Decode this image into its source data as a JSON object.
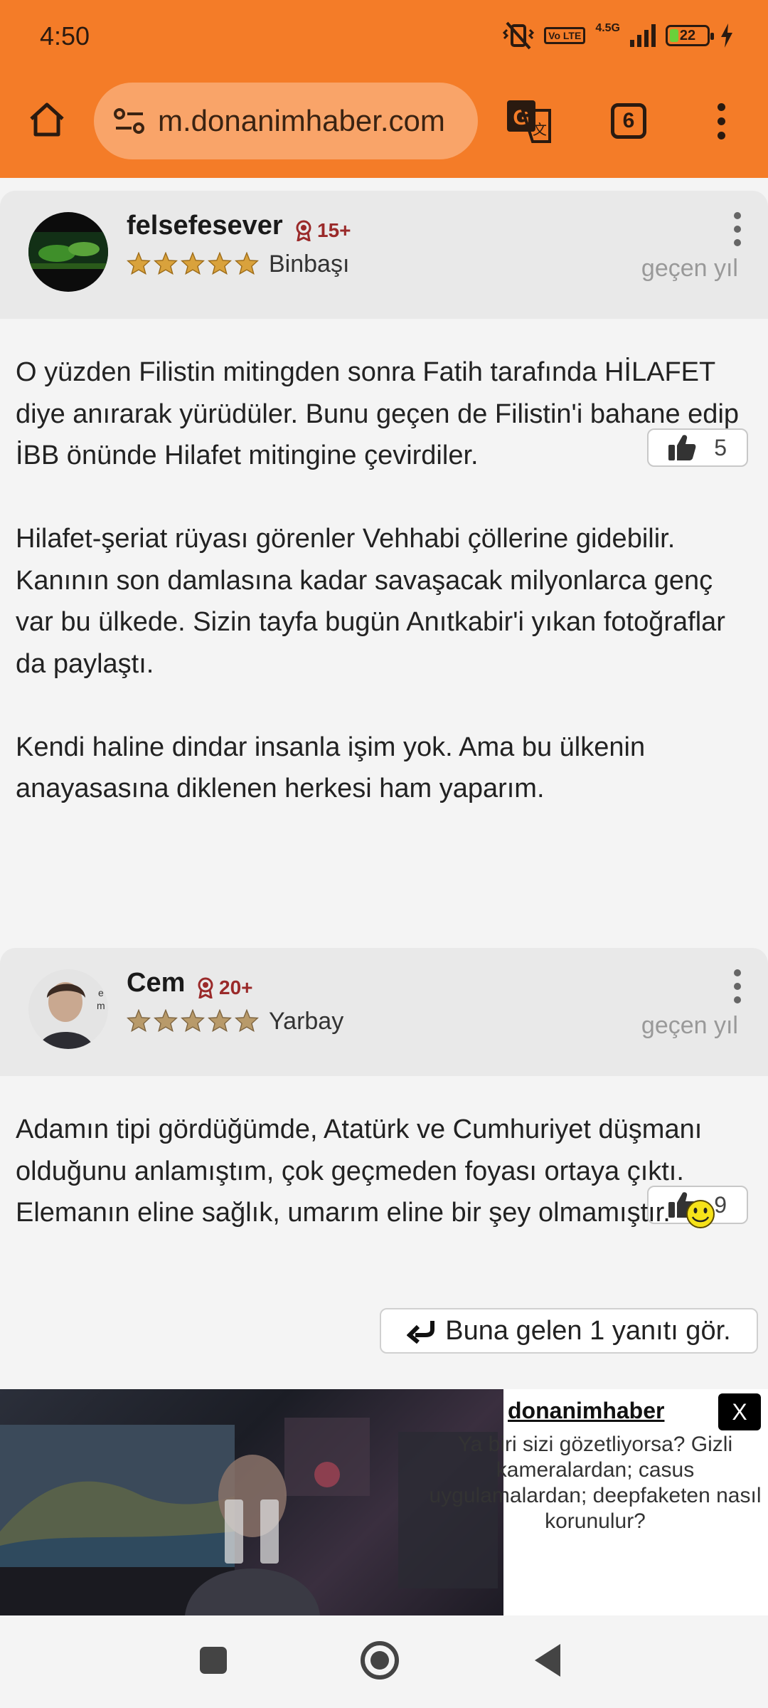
{
  "status_bar": {
    "time": "4:50",
    "network": "4.5G",
    "volte": "Vo LTE",
    "battery": "22"
  },
  "browser": {
    "url": "m.donanimhaber.com",
    "tab_count": "6"
  },
  "comments": [
    {
      "username": "felsefesever",
      "badge": "15+",
      "rank": "Binbaşı",
      "time": "geçen yıl",
      "likes": "5",
      "paragraphs": [
        "O yüzden Filistin mitingden sonra Fatih tarafında HİLAFET diye anırarak yürüdüler. Bunu geçen de Filistin'i bahane edip İBB önünde Hilafet mitingine çevirdiler.",
        "",
        "Hilafet-şeriat rüyası görenler Vehhabi çöllerine gidebilir. Kanının son damlasına kadar savaşacak milyonlarca genç var bu ülkede. Sizin tayfa bugün Anıtkabir'i yıkan fotoğraflar da paylaştı.",
        "",
        "Kendi haline dindar insanla işim yok. Ama bu ülkenin anayasasına diklenen herkesi ham yaparım."
      ]
    },
    {
      "username": "Cem",
      "badge": "20+",
      "rank": "Yarbay",
      "time": "geçen yıl",
      "likes": "9",
      "paragraphs": [
        "Adamın tipi gördüğümde, Atatürk ve Cumhuriyet düşmanı olduğunu anlamıştım, çok geçmeden foyası ortaya çıktı. Elemanın eline sağlık, umarım eline bir şey olmamıştır."
      ],
      "reply_label": "Buna gelen 1 yanıtı gör."
    }
  ],
  "ad": {
    "brand": "donanimhaber",
    "close_label": "X",
    "text": "Ya biri sizi gözetliyorsa? Gizli kameralardan; casus uygulamalardan; deepfaketen nasıl korunulur?"
  },
  "colors": {
    "toolbar": "#f47c28",
    "urlbar": "#f9a469",
    "badge": "#9a2a2a",
    "star": "#d9a23c"
  },
  "icons": [
    "home-icon",
    "site-info-icon",
    "translate-icon",
    "tabs-icon",
    "more-icon",
    "medal-icon",
    "star-icon",
    "thumbs-up-icon",
    "reply-arrow-icon",
    "smiley-icon",
    "pause-icon",
    "recents-icon",
    "home-nav-icon",
    "back-icon"
  ]
}
